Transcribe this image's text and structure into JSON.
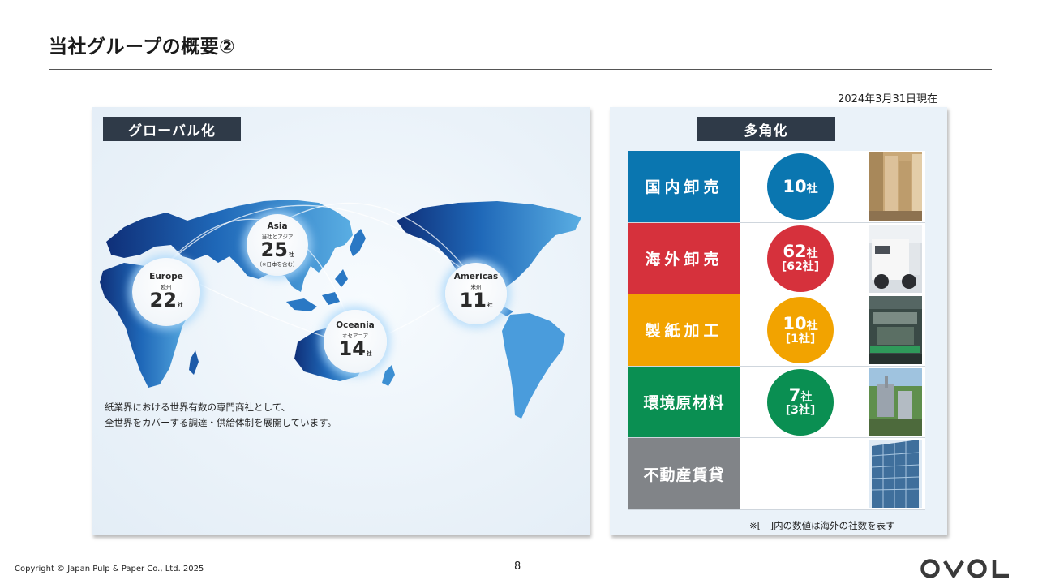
{
  "page": {
    "title": "当社グループの概要②",
    "as_of_date": "2024年3月31日現在",
    "copyright": "Copyright © Japan Pulp & Paper Co., Ltd. 2025",
    "page_number": "8",
    "logo_text": "OVOL"
  },
  "globalization": {
    "header": "グローバル化",
    "regions": [
      {
        "name": "Asia",
        "sub": "当社とアジア",
        "count": "25",
        "unit": "社",
        "note": "（※日本を含む）"
      },
      {
        "name": "Europe",
        "sub": "欧州",
        "count": "22",
        "unit": "社"
      },
      {
        "name": "Americas",
        "sub": "米州",
        "count": "11",
        "unit": "社"
      },
      {
        "name": "Oceania",
        "sub": "オセアニア",
        "count": "14",
        "unit": "社"
      }
    ],
    "caption_lines": [
      "紙業界における世界有数の専門商社として、",
      "全世界をカバーする調達・供給体制を展開しています。"
    ]
  },
  "diversification": {
    "header": "多角化",
    "rows": [
      {
        "label": "国内卸売",
        "count": "10",
        "unit": "社",
        "overseas": "",
        "color": "#0a76b0"
      },
      {
        "label": "海外卸売",
        "count": "62",
        "unit": "社",
        "overseas": "[62社]",
        "color": "#d6313c"
      },
      {
        "label": "製紙加工",
        "count": "10",
        "unit": "社",
        "overseas": "[1社]",
        "color": "#f2a300"
      },
      {
        "label": "環境原材料",
        "count": "7",
        "unit": "社",
        "overseas": "[3社]",
        "color": "#0a8f52"
      },
      {
        "label": "不動産賃貸",
        "count": "",
        "unit": "",
        "overseas": "",
        "color": "#818488"
      }
    ],
    "footnote": "※[　]内の数値は海外の社数を表す"
  },
  "colors": {
    "header_bg": "#2f3a48",
    "map_blue_dark": "#123f8c",
    "map_blue_light": "#4fa3dd"
  }
}
